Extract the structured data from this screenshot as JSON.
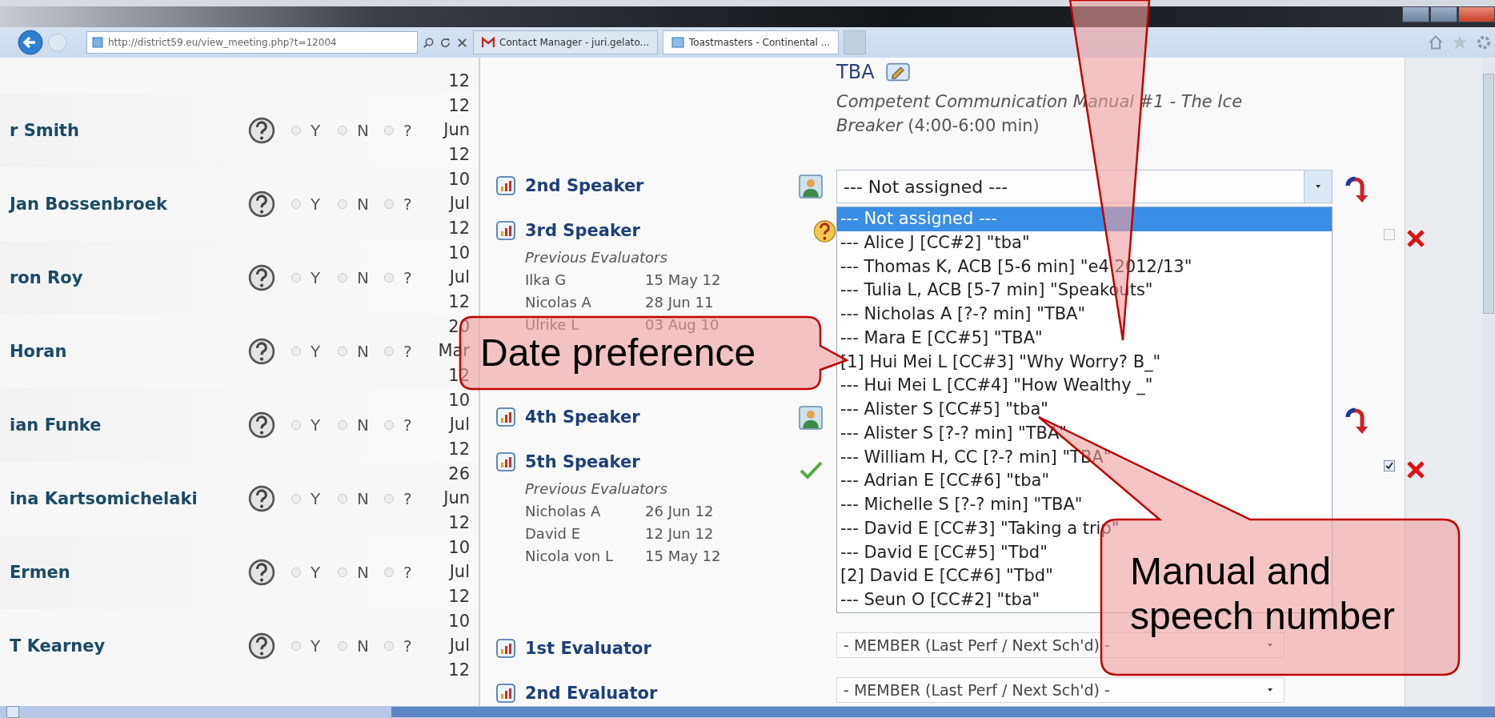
{
  "browser": {
    "address": "http://district59.eu/view_meeting.php?t=12004",
    "tabs": [
      {
        "label": "Contact Manager - juri.gelato...",
        "selected": false,
        "kind": "mail"
      },
      {
        "label": "Toastmasters - Continental ...",
        "selected": true,
        "kind": "page"
      }
    ]
  },
  "members": {
    "top_date": "12",
    "rows": [
      {
        "name": "r Smith",
        "day": "12",
        "month": "Jun",
        "year": "12",
        "options": [
          {
            "label": "Y",
            "selected": false
          },
          {
            "label": "N",
            "selected": false
          },
          {
            "label": "?",
            "selected": false
          }
        ]
      },
      {
        "name": "Jan Bossenbroek",
        "day": "10",
        "month": "Jul",
        "year": "12",
        "options": [
          {
            "label": "Y",
            "selected": false
          },
          {
            "label": "N",
            "selected": false
          },
          {
            "label": "?",
            "selected": false
          }
        ]
      },
      {
        "name": "ron Roy",
        "day": "10",
        "month": "Jul",
        "year": "12",
        "options": [
          {
            "label": "Y",
            "selected": false
          },
          {
            "label": "N",
            "selected": false
          },
          {
            "label": "?",
            "selected": false
          }
        ]
      },
      {
        "name": "Horan",
        "day": "20",
        "month": "Mar",
        "year": "12",
        "options": [
          {
            "label": "Y",
            "selected": false
          },
          {
            "label": "N",
            "selected": false
          },
          {
            "label": "?",
            "selected": false
          }
        ]
      },
      {
        "name": "ian Funke",
        "day": "10",
        "month": "Jul",
        "year": "12",
        "options": [
          {
            "label": "Y",
            "selected": false
          },
          {
            "label": "N",
            "selected": false
          },
          {
            "label": "?",
            "selected": false
          }
        ]
      },
      {
        "name": "ina Kartsomichelaki",
        "day": "26",
        "month": "Jun",
        "year": "12",
        "options": [
          {
            "label": "Y",
            "selected": false
          },
          {
            "label": "N",
            "selected": false
          },
          {
            "label": "?",
            "selected": false
          }
        ]
      },
      {
        "name": "Ermen",
        "day": "10",
        "month": "Jul",
        "year": "12",
        "options": [
          {
            "label": "Y",
            "selected": false
          },
          {
            "label": "N",
            "selected": false
          },
          {
            "label": "?",
            "selected": false
          }
        ]
      },
      {
        "name": "T Kearney",
        "day": "10",
        "month": "Jul",
        "year": "12",
        "options": [
          {
            "label": "Y",
            "selected": false
          },
          {
            "label": "N",
            "selected": false
          },
          {
            "label": "?",
            "selected": false
          }
        ]
      }
    ]
  },
  "speech": {
    "speaker": "TBA",
    "description": "*Competent Communication Manual #1 - The Ice Breaker* (4:00-6:00 min)"
  },
  "roles": [
    {
      "label": "2nd Speaker",
      "kind": "person",
      "select": "--- Not assigned ---",
      "swap": true,
      "dropdown": [
        {
          "label": "--- Not assigned ---",
          "selected": true
        },
        {
          "label": "--- Alice J [CC#2] \"tba\"",
          "selected": false
        },
        {
          "label": "--- Thomas K, ACB [5-6 min] \"e4 2012/13\"",
          "selected": false
        },
        {
          "label": "--- Tulia L, ACB [5-7 min] \"Speakouts\"",
          "selected": false
        },
        {
          "label": "--- Nicholas A [?-? min] \"TBA\"",
          "selected": false
        },
        {
          "label": "--- Mara E [CC#5] \"TBA\"",
          "selected": false
        },
        {
          "label": "[1] Hui Mei L [CC#3] \"Why Worry? B_\"",
          "selected": false
        },
        {
          "label": "--- Hui Mei L [CC#4] \"How Wealthy _\"",
          "selected": false
        },
        {
          "label": "--- Alister S [CC#5] \"tba\"",
          "selected": false
        },
        {
          "label": "--- Alister S [?-? min] \"TBA\"",
          "selected": false
        },
        {
          "label": "--- William H, CC [?-? min] \"TBA\"",
          "selected": false
        },
        {
          "label": "--- Adrian E [CC#6] \"tba\"",
          "selected": false
        },
        {
          "label": "--- Michelle S [?-? min] \"TBA\"",
          "selected": false
        },
        {
          "label": "--- David E [CC#3] \"Taking a trip\"",
          "selected": false
        },
        {
          "label": "--- David E [CC#5] \"Tbd\"",
          "selected": false
        },
        {
          "label": "[2] David E [CC#6] \"Tbd\"",
          "selected": false
        },
        {
          "label": "--- Seun O [CC#2] \"tba\"",
          "selected": false
        }
      ]
    },
    {
      "label": "3rd Speaker",
      "kind": "question",
      "checked": false,
      "removable": true,
      "previous_title": "Previous Evaluators",
      "previous": [
        {
          "name": "Ilka G",
          "date": "15 May 12"
        },
        {
          "name": "Nicolas A",
          "date": "28 Jun 11"
        },
        {
          "name": "Ulrike L",
          "date": "03 Aug 10"
        }
      ]
    },
    {
      "label": "4th Speaker",
      "kind": "person",
      "swap": true
    },
    {
      "label": "5th Speaker",
      "kind": "check",
      "checked": true,
      "removable": true,
      "previous_title": "Previous Evaluators",
      "previous": [
        {
          "name": "Nicholas A",
          "date": "26 Jun 12"
        },
        {
          "name": "David E",
          "date": "12 Jun 12"
        },
        {
          "name": "Nicola von L",
          "date": "15 May 12"
        }
      ]
    },
    {
      "label": "1st Evaluator",
      "select": "- MEMBER (Last Perf / Next Sch'd) -"
    },
    {
      "label": "2nd Evaluator",
      "select": "- MEMBER (Last Perf / Next Sch'd) -"
    }
  ],
  "annotations": [
    {
      "kind": "pointer"
    },
    {
      "kind": "left",
      "text": "Date preference"
    },
    {
      "kind": "below",
      "text": "Manual and speech number"
    }
  ]
}
